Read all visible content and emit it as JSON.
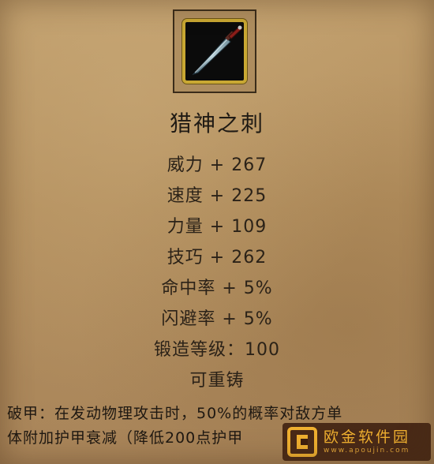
{
  "item": {
    "name": "猎神之刺",
    "icon": "dagger-icon"
  },
  "stats": [
    "威力 + 267",
    "速度 + 225",
    "力量 + 109",
    "技巧 + 262",
    "命中率 + 5%",
    "闪避率 + 5%",
    "锻造等级：100",
    "可重铸"
  ],
  "description": {
    "line1": "破甲：在发动物理攻击时，50%的概率对敌方单",
    "line2": "体附加护甲衰减（降低200点护甲"
  },
  "watermark": {
    "name": "欧金软件园",
    "url": "www.apoujin.com"
  },
  "colors": {
    "parchment": "#b38f5e",
    "icon_border": "#c9a833",
    "text": "#2b2218"
  }
}
